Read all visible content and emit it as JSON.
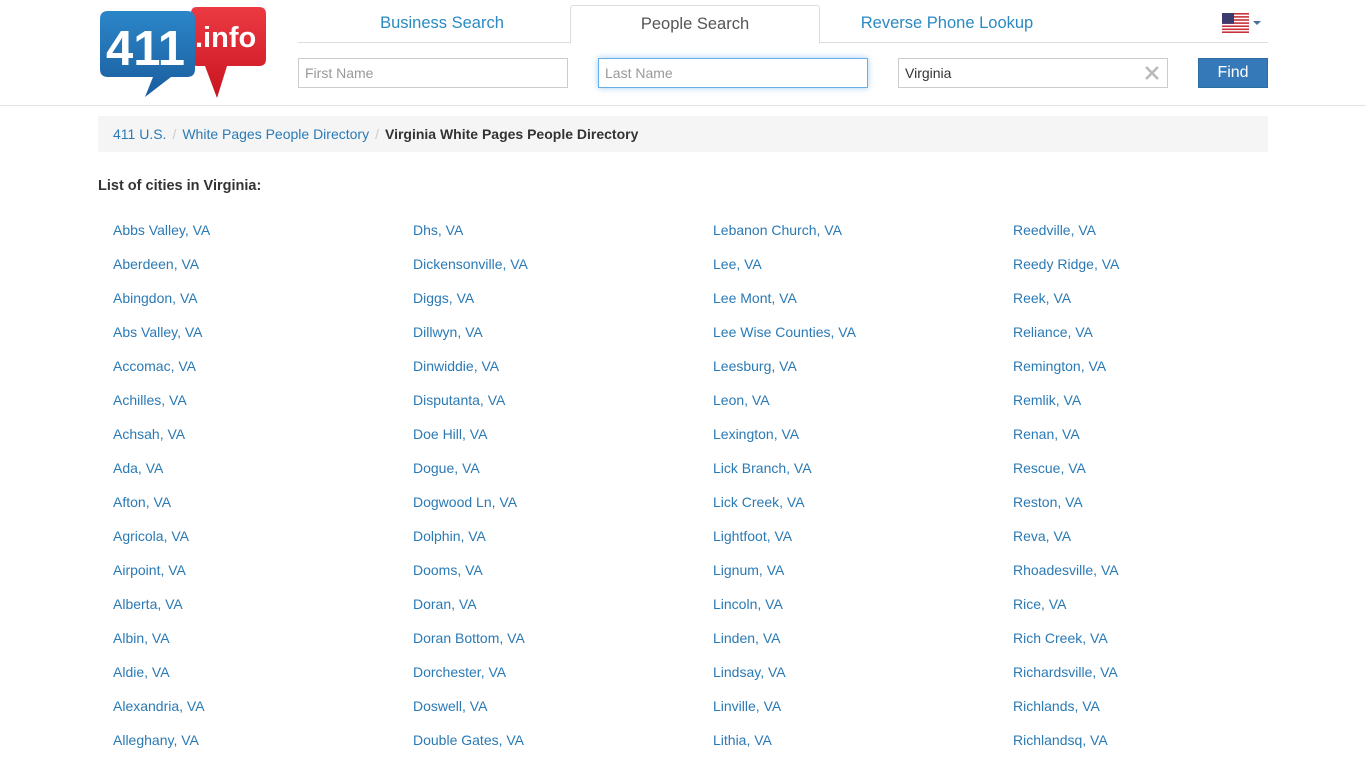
{
  "logo": {
    "left_text": "411",
    "right_text": ".info",
    "blue": "#1f6fb4",
    "red": "#e0202f"
  },
  "tabs": [
    {
      "label": "Business Search",
      "active": false
    },
    {
      "label": "People Search",
      "active": true
    },
    {
      "label": "Reverse Phone Lookup",
      "active": false
    }
  ],
  "country_selector": {
    "icon": "us-flag-icon"
  },
  "search": {
    "first_name": {
      "value": "",
      "placeholder": "First Name"
    },
    "last_name": {
      "value": "",
      "placeholder": "Last Name"
    },
    "location": {
      "value": "Virginia",
      "placeholder": ""
    },
    "find_label": "Find"
  },
  "breadcrumb": {
    "items": [
      "411 U.S.",
      "White Pages People Directory"
    ],
    "separator": "/",
    "active": "Virginia White Pages People Directory"
  },
  "list_title": "List of cities in Virginia:",
  "columns": [
    [
      "Abbs Valley, VA",
      "Aberdeen, VA",
      "Abingdon, VA",
      "Abs Valley, VA",
      "Accomac, VA",
      "Achilles, VA",
      "Achsah, VA",
      "Ada, VA",
      "Afton, VA",
      "Agricola, VA",
      "Airpoint, VA",
      "Alberta, VA",
      "Albin, VA",
      "Aldie, VA",
      "Alexandria, VA",
      "Alleghany, VA"
    ],
    [
      "Dhs, VA",
      "Dickensonville, VA",
      "Diggs, VA",
      "Dillwyn, VA",
      "Dinwiddie, VA",
      "Disputanta, VA",
      "Doe Hill, VA",
      "Dogue, VA",
      "Dogwood Ln, VA",
      "Dolphin, VA",
      "Dooms, VA",
      "Doran, VA",
      "Doran Bottom, VA",
      "Dorchester, VA",
      "Doswell, VA",
      "Double Gates, VA"
    ],
    [
      "Lebanon Church, VA",
      "Lee, VA",
      "Lee Mont, VA",
      "Lee Wise Counties, VA",
      "Leesburg, VA",
      "Leon, VA",
      "Lexington, VA",
      "Lick Branch, VA",
      "Lick Creek, VA",
      "Lightfoot, VA",
      "Lignum, VA",
      "Lincoln, VA",
      "Linden, VA",
      "Lindsay, VA",
      "Linville, VA",
      "Lithia, VA"
    ],
    [
      "Reedville, VA",
      "Reedy Ridge, VA",
      "Reek, VA",
      "Reliance, VA",
      "Remington, VA",
      "Remlik, VA",
      "Renan, VA",
      "Rescue, VA",
      "Reston, VA",
      "Reva, VA",
      "Rhoadesville, VA",
      "Rice, VA",
      "Rich Creek, VA",
      "Richardsville, VA",
      "Richlands, VA",
      "Richlandsq, VA"
    ]
  ]
}
